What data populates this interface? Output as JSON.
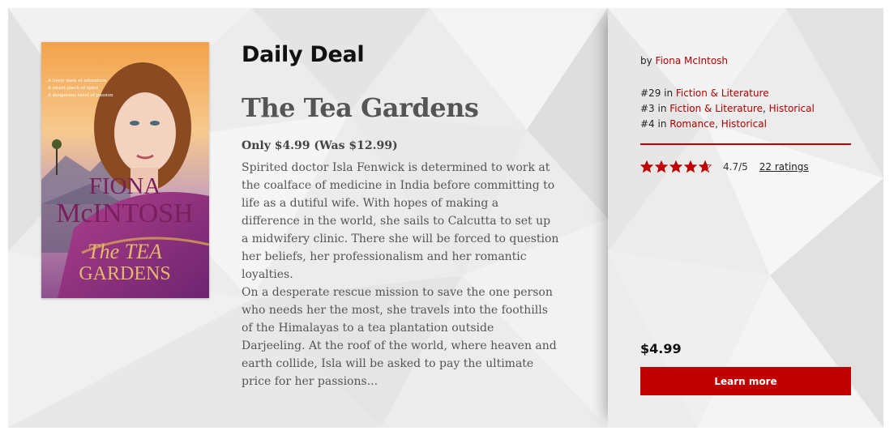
{
  "deal": {
    "label": "Daily Deal",
    "title": "The Tea Gardens",
    "price_line": "Only $4.99 (Was $12.99)",
    "description": [
      "Spirited doctor Isla Fenwick is determined to work at the coalface of medicine in India before committing to life as a dutiful wife. With hopes of making a difference in the world, she sails to Calcutta to set up a midwifery clinic. There she will be forced to question her beliefs, her professionalism and her romantic loyalties.",
      "On a desperate rescue mission to save the one person who needs her the most, she travels into the foothills of the Himalayas to a tea plantation outside Darjeeling. At the roof of the world, where heaven and earth collide, Isla will be asked to pay the ultimate price for her passions..."
    ]
  },
  "cover": {
    "tagline_1": "A lively dash of adventure",
    "tagline_2": "A sweet pinch of spice",
    "tagline_3": "A dangerous twist of passion",
    "author_first": "FIONA",
    "author_last": "McINTOSH",
    "title_top": "The TEA",
    "title_bottom": "GARDENS"
  },
  "sidebar": {
    "by": "by",
    "author": "Fiona McIntosh",
    "rank1_prefix": "#29 in",
    "rank1_cat": "Fiction & Literature",
    "rank2_prefix": "#3 in",
    "rank2_cat": "Fiction & Literature",
    "rank2_sub": "Historical",
    "rank3_prefix": "#4 in",
    "rank3_cat": "Romance",
    "rank3_sub": "Historical",
    "rating_text": "4.7/5",
    "rating_value": 4.7,
    "rating_max": 5,
    "ratings_count": "22 ratings",
    "price": "$4.99",
    "cta": "Learn more"
  },
  "colors": {
    "accent": "#c00000",
    "link": "#b00000"
  }
}
